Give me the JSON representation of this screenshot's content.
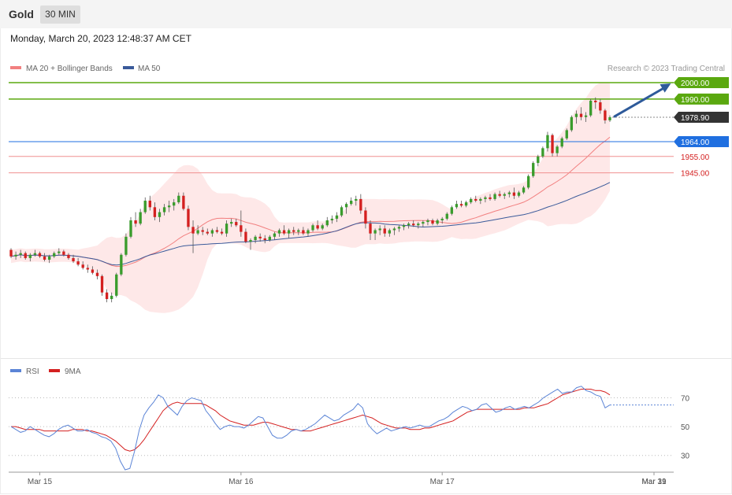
{
  "header": {
    "title": "Gold",
    "interval": "30 MIN"
  },
  "timestamp": "Monday, March 20, 2023 12:48:37 AM CET",
  "legend": {
    "ma20_bb": "MA 20 + Bollinger Bands",
    "ma50": "MA 50",
    "credit": "Research © 2023 Trading Central"
  },
  "rsi_legend": {
    "rsi": "RSI",
    "ma9": "9MA"
  },
  "levels": {
    "r2": "2000.00",
    "r1": "1990.00",
    "last": "1978.90",
    "pivot": "1964.00",
    "s1": "1955.00",
    "s2": "1945.00"
  },
  "colors": {
    "up": "#3a9c2c",
    "down": "#d42020",
    "resistance": "#5aa80f",
    "pivot": "#1f6fe0",
    "support": "#d42020",
    "ma20": "#f28080",
    "ma50": "#3a5a9a",
    "rsi": "#5b84d6",
    "rsi_ma": "#d42020",
    "arrow": "#2e5a9a"
  },
  "chart_data": [
    {
      "type": "candlestick",
      "title": "Gold",
      "interval": "30 MIN",
      "ylim": [
        1832,
        2012
      ],
      "x_ticks": [
        "Mar 15",
        "Mar 16",
        "Mar 17",
        "Mar 19",
        "Mar 31"
      ],
      "bars": [
        [
          1898,
          1899,
          1893,
          1894
        ],
        [
          1894,
          1897,
          1892,
          1895
        ],
        [
          1895,
          1898,
          1893,
          1896
        ],
        [
          1896,
          1897,
          1892,
          1893
        ],
        [
          1893,
          1896,
          1891,
          1895
        ],
        [
          1895,
          1898,
          1894,
          1896
        ],
        [
          1896,
          1897,
          1893,
          1894
        ],
        [
          1894,
          1896,
          1891,
          1892
        ],
        [
          1892,
          1895,
          1890,
          1894
        ],
        [
          1894,
          1897,
          1893,
          1896
        ],
        [
          1896,
          1899,
          1895,
          1897
        ],
        [
          1897,
          1898,
          1894,
          1895
        ],
        [
          1895,
          1896,
          1892,
          1893
        ],
        [
          1893,
          1895,
          1890,
          1891
        ],
        [
          1891,
          1893,
          1888,
          1889
        ],
        [
          1889,
          1891,
          1886,
          1887
        ],
        [
          1887,
          1889,
          1884,
          1886
        ],
        [
          1886,
          1888,
          1883,
          1884
        ],
        [
          1884,
          1886,
          1880,
          1882
        ],
        [
          1882,
          1883,
          1870,
          1872
        ],
        [
          1872,
          1874,
          1866,
          1868
        ],
        [
          1868,
          1872,
          1866,
          1870
        ],
        [
          1870,
          1884,
          1869,
          1883
        ],
        [
          1883,
          1896,
          1882,
          1895
        ],
        [
          1895,
          1908,
          1894,
          1906
        ],
        [
          1906,
          1918,
          1905,
          1916
        ],
        [
          1916,
          1921,
          1912,
          1914
        ],
        [
          1914,
          1923,
          1913,
          1921
        ],
        [
          1921,
          1930,
          1920,
          1928
        ],
        [
          1928,
          1931,
          1922,
          1924
        ],
        [
          1924,
          1927,
          1916,
          1918
        ],
        [
          1918,
          1923,
          1915,
          1921
        ],
        [
          1921,
          1926,
          1919,
          1924
        ],
        [
          1924,
          1928,
          1921,
          1925
        ],
        [
          1925,
          1929,
          1922,
          1927
        ],
        [
          1927,
          1933,
          1926,
          1931
        ],
        [
          1931,
          1933,
          1922,
          1923
        ],
        [
          1923,
          1925,
          1910,
          1912
        ],
        [
          1912,
          1916,
          1896,
          1908
        ],
        [
          1908,
          1913,
          1907,
          1910
        ],
        [
          1910,
          1912,
          1907,
          1909
        ],
        [
          1909,
          1911,
          1907,
          1908
        ],
        [
          1908,
          1911,
          1906,
          1910
        ],
        [
          1910,
          1912,
          1908,
          1909
        ],
        [
          1909,
          1911,
          1907,
          1908
        ],
        [
          1908,
          1916,
          1906,
          1914
        ],
        [
          1914,
          1917,
          1912,
          1915
        ],
        [
          1915,
          1917,
          1912,
          1913
        ],
        [
          1913,
          1922,
          1906,
          1909
        ],
        [
          1909,
          1911,
          1902,
          1903
        ],
        [
          1903,
          1905,
          1898,
          1904
        ],
        [
          1904,
          1907,
          1902,
          1906
        ],
        [
          1906,
          1908,
          1903,
          1905
        ],
        [
          1905,
          1907,
          1902,
          1904
        ],
        [
          1904,
          1907,
          1903,
          1906
        ],
        [
          1906,
          1909,
          1904,
          1908
        ],
        [
          1908,
          1911,
          1906,
          1910
        ],
        [
          1910,
          1913,
          1907,
          1908
        ],
        [
          1908,
          1911,
          1905,
          1910
        ],
        [
          1910,
          1912,
          1907,
          1909
        ],
        [
          1909,
          1911,
          1907,
          1910
        ],
        [
          1910,
          1912,
          1907,
          1908
        ],
        [
          1908,
          1911,
          1906,
          1910
        ],
        [
          1910,
          1914,
          1909,
          1913
        ],
        [
          1913,
          1916,
          1910,
          1911
        ],
        [
          1911,
          1914,
          1910,
          1913
        ],
        [
          1913,
          1918,
          1912,
          1916
        ],
        [
          1916,
          1919,
          1914,
          1917
        ],
        [
          1917,
          1921,
          1915,
          1919
        ],
        [
          1919,
          1925,
          1918,
          1924
        ],
        [
          1924,
          1927,
          1920,
          1926
        ],
        [
          1926,
          1930,
          1925,
          1928
        ],
        [
          1928,
          1931,
          1925,
          1929
        ],
        [
          1929,
          1932,
          1920,
          1922
        ],
        [
          1922,
          1924,
          1911,
          1914
        ],
        [
          1914,
          1916,
          1904,
          1908
        ],
        [
          1908,
          1911,
          1904,
          1910
        ],
        [
          1910,
          1913,
          1907,
          1911
        ],
        [
          1911,
          1913,
          1906,
          1908
        ],
        [
          1908,
          1911,
          1906,
          1910
        ],
        [
          1910,
          1912,
          1907,
          1911
        ],
        [
          1911,
          1913,
          1909,
          1912
        ],
        [
          1912,
          1914,
          1910,
          1913
        ],
        [
          1913,
          1915,
          1911,
          1914
        ],
        [
          1914,
          1916,
          1912,
          1913
        ],
        [
          1913,
          1915,
          1911,
          1914
        ],
        [
          1914,
          1916,
          1912,
          1915
        ],
        [
          1915,
          1917,
          1913,
          1916
        ],
        [
          1916,
          1917,
          1913,
          1914
        ],
        [
          1914,
          1917,
          1913,
          1916
        ],
        [
          1916,
          1918,
          1914,
          1917
        ],
        [
          1917,
          1921,
          1916,
          1920
        ],
        [
          1920,
          1925,
          1919,
          1924
        ],
        [
          1924,
          1928,
          1923,
          1926
        ],
        [
          1926,
          1928,
          1924,
          1925
        ],
        [
          1925,
          1928,
          1924,
          1927
        ],
        [
          1927,
          1930,
          1926,
          1929
        ],
        [
          1929,
          1931,
          1927,
          1928
        ],
        [
          1928,
          1930,
          1926,
          1929
        ],
        [
          1929,
          1931,
          1927,
          1930
        ],
        [
          1930,
          1932,
          1928,
          1929
        ],
        [
          1929,
          1933,
          1928,
          1932
        ],
        [
          1932,
          1934,
          1930,
          1931
        ],
        [
          1931,
          1933,
          1929,
          1932
        ],
        [
          1932,
          1934,
          1930,
          1933
        ],
        [
          1933,
          1936,
          1929,
          1931
        ],
        [
          1931,
          1934,
          1930,
          1933
        ],
        [
          1933,
          1937,
          1932,
          1936
        ],
        [
          1936,
          1944,
          1935,
          1943
        ],
        [
          1943,
          1952,
          1942,
          1951
        ],
        [
          1951,
          1956,
          1949,
          1955
        ],
        [
          1955,
          1961,
          1954,
          1960
        ],
        [
          1960,
          1970,
          1958,
          1968
        ],
        [
          1968,
          1969,
          1955,
          1957
        ],
        [
          1957,
          1962,
          1955,
          1961
        ],
        [
          1961,
          1967,
          1960,
          1966
        ],
        [
          1966,
          1972,
          1965,
          1971
        ],
        [
          1971,
          1980,
          1970,
          1979
        ],
        [
          1979,
          1983,
          1975,
          1981
        ],
        [
          1981,
          1985,
          1977,
          1979
        ],
        [
          1979,
          1982,
          1976,
          1980
        ],
        [
          1980,
          1990,
          1979,
          1989
        ],
        [
          1989,
          1991,
          1984,
          1988
        ],
        [
          1988,
          1990,
          1981,
          1983
        ],
        [
          1983,
          1984,
          1975,
          1977
        ],
        [
          1977,
          1980,
          1976,
          1978.9
        ]
      ],
      "series": [
        {
          "name": "MA 20 + Bollinger Bands"
        },
        {
          "name": "MA 50"
        }
      ],
      "levels": [
        2000.0,
        1990.0,
        1978.9,
        1964.0,
        1955.0,
        1945.0
      ]
    },
    {
      "type": "line",
      "title": "",
      "ylim": [
        20,
        85
      ],
      "y_ticks": [
        30,
        50,
        70
      ],
      "grid": true,
      "series": [
        {
          "name": "RSI",
          "values": [
            50,
            48,
            46,
            47,
            50,
            48,
            46,
            44,
            43,
            45,
            48,
            50,
            51,
            49,
            47,
            47,
            48,
            46,
            45,
            43,
            42,
            40,
            35,
            26,
            20,
            21,
            33,
            48,
            58,
            63,
            67,
            72,
            70,
            64,
            61,
            58,
            64,
            68,
            70,
            69,
            68,
            61,
            57,
            52,
            48,
            50,
            51,
            50,
            50,
            49,
            51,
            54,
            57,
            56,
            50,
            44,
            42,
            42,
            44,
            47,
            48,
            47,
            48,
            50,
            52,
            55,
            58,
            56,
            54,
            55,
            58,
            60,
            62,
            66,
            63,
            52,
            48,
            45,
            47,
            49,
            47,
            48,
            49,
            50,
            49,
            50,
            51,
            50,
            50,
            52,
            54,
            55,
            57,
            60,
            62,
            64,
            63,
            61,
            62,
            65,
            66,
            63,
            60,
            61,
            63,
            64,
            62,
            63,
            64,
            63,
            65,
            67,
            70,
            72,
            74,
            76,
            73,
            74,
            74,
            77,
            78,
            75,
            74,
            72,
            71,
            63,
            65
          ]
        },
        {
          "name": "9MA",
          "values": [
            50,
            50,
            49,
            48,
            48,
            48,
            48,
            47,
            47,
            47,
            47,
            47,
            47,
            48,
            48,
            48,
            47,
            47,
            46,
            45,
            44,
            42,
            40,
            37,
            34,
            33,
            34,
            37,
            41,
            46,
            51,
            56,
            61,
            64,
            66,
            67,
            66,
            66,
            66,
            66,
            66,
            65,
            63,
            61,
            58,
            56,
            54,
            53,
            52,
            51,
            51,
            51,
            52,
            53,
            53,
            52,
            51,
            50,
            49,
            48,
            48,
            47,
            47,
            47,
            48,
            49,
            50,
            51,
            52,
            53,
            54,
            55,
            56,
            57,
            58,
            57,
            56,
            54,
            52,
            51,
            50,
            49,
            49,
            49,
            48,
            48,
            48,
            49,
            49,
            50,
            51,
            52,
            53,
            54,
            56,
            58,
            60,
            61,
            62,
            62,
            62,
            62,
            62,
            62,
            62,
            62,
            62,
            62,
            63,
            63,
            63,
            64,
            65,
            66,
            68,
            70,
            72,
            73,
            74,
            75,
            76,
            76,
            76,
            75,
            75,
            74,
            72
          ]
        }
      ]
    }
  ]
}
